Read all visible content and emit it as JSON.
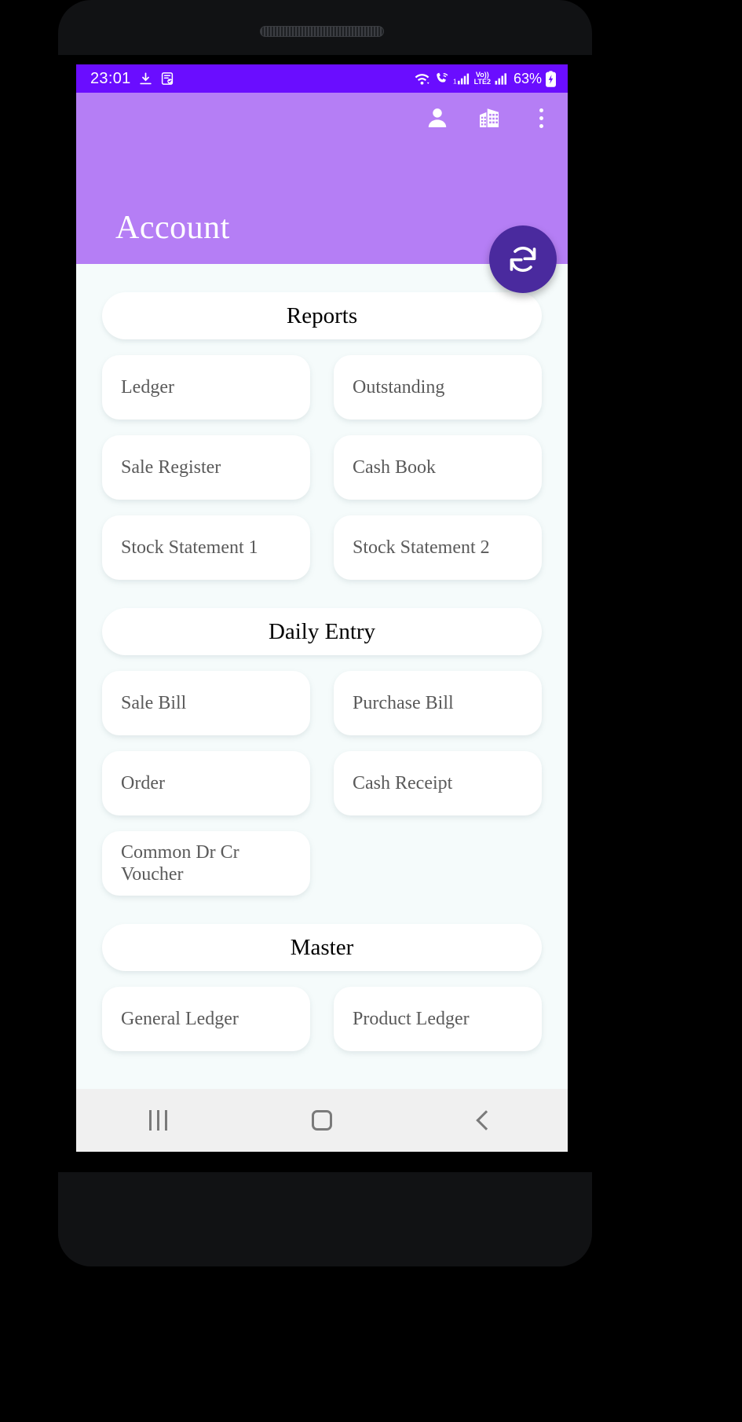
{
  "status_bar": {
    "time": "23:01",
    "left_icons": [
      "download-complete-icon",
      "note-check-icon"
    ],
    "right_icons": [
      "wifi-icon",
      "call-wifi-icon",
      "signal-bars-1-icon",
      "volte-lte2-icon",
      "signal-bars-2-icon"
    ],
    "volte_top": "Vo))",
    "volte_bottom": "LTE2",
    "sim1_label": "1",
    "battery_text": "63%",
    "background_color": "#6a0dff"
  },
  "app_bar": {
    "title": "Account",
    "background_color": "#b57ef5",
    "actions": [
      {
        "name": "person-icon",
        "label": "Profile"
      },
      {
        "name": "building-icon",
        "label": "Company"
      },
      {
        "name": "overflow-menu-icon",
        "label": "More options"
      }
    ]
  },
  "fab": {
    "icon": "refresh-sync-icon",
    "label": "Sync",
    "color": "#4a2a9e"
  },
  "sections": [
    {
      "title": "Reports",
      "items": [
        "Ledger",
        "Outstanding",
        "Sale Register",
        "Cash Book",
        "Stock Statement 1",
        "Stock Statement 2"
      ]
    },
    {
      "title": "Daily Entry",
      "items": [
        "Sale Bill",
        "Purchase Bill",
        "Order",
        "Cash Receipt",
        "Common Dr Cr Voucher"
      ]
    },
    {
      "title": "Master",
      "items": [
        "General Ledger",
        "Product Ledger"
      ]
    }
  ],
  "navigation_bar": {
    "buttons": [
      {
        "name": "recents-button",
        "label": "Recents"
      },
      {
        "name": "home-button",
        "label": "Home"
      },
      {
        "name": "back-button",
        "label": "Back"
      }
    ]
  }
}
